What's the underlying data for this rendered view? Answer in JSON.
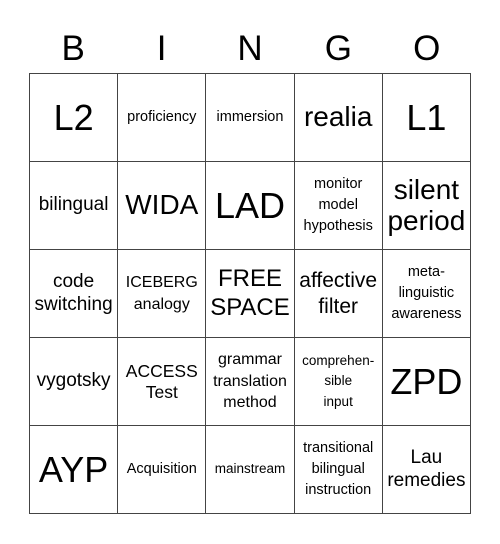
{
  "header": {
    "letters": [
      "B",
      "I",
      "N",
      "G",
      "O"
    ]
  },
  "card": {
    "rows": [
      [
        "L2",
        "proficiency",
        "immersion",
        "realia",
        "L1"
      ],
      [
        "bilingual",
        "WIDA",
        "LAD",
        "monitor\nmodel\nhypothesis",
        "silent\nperiod"
      ],
      [
        "code\nswitching",
        "ICEBERG\nanalogy",
        "FREE\nSPACE",
        "affective\nfilter",
        "meta-\nlinguistic\nawareness"
      ],
      [
        "vygotsky",
        "ACCESS\nTest",
        "grammar\ntranslation\nmethod",
        "comprehen-\nsible\ninput",
        "ZPD"
      ],
      [
        "AYP",
        "Acquisition",
        "mainstream",
        "transitional\nbilingual\ninstruction",
        "Lau\nremedies"
      ]
    ],
    "free_space_label": "FREE\nSPACE"
  },
  "colors": {
    "border": "#444444",
    "text": "#000000",
    "background": "#ffffff"
  }
}
